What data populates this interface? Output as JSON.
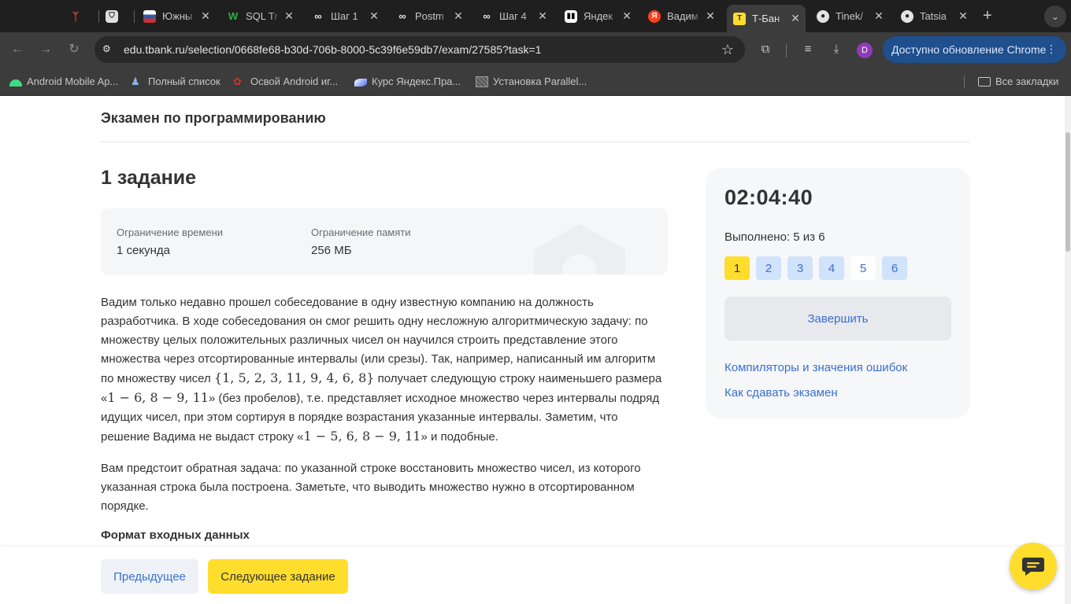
{
  "browser": {
    "tabs": [
      {
        "title": "",
        "icon": "red-figure-icon",
        "color": "#e53935"
      },
      {
        "title": "",
        "icon": "shield-icon",
        "color": "#3c3c3c"
      },
      {
        "title": "Южны",
        "icon": "flag-icon",
        "color": "#b44"
      },
      {
        "title": "SQL Tr",
        "icon": "w-logo-icon",
        "color": "#1b8a3a"
      },
      {
        "title": "Шаг 1",
        "icon": "stepik-icon",
        "color": "#2b2b2b"
      },
      {
        "title": "Postm",
        "icon": "stepik-icon",
        "color": "#2b2b2b"
      },
      {
        "title": "Шаг 4",
        "icon": "stepik-icon",
        "color": "#2b2b2b"
      },
      {
        "title": "Яндек",
        "icon": "yandex-practicum-icon",
        "color": "#222"
      },
      {
        "title": "Вадим",
        "icon": "yandex-icon",
        "color": "#fc3f1d"
      },
      {
        "title": "Т-Бан",
        "icon": "tbank-icon",
        "color": "#ffdd2d"
      },
      {
        "title": "Tinek/",
        "icon": "github-icon",
        "color": "#222"
      },
      {
        "title": "Tatsia",
        "icon": "github-icon",
        "color": "#222"
      }
    ],
    "url": "edu.tbank.ru/selection/0668fe68-b30d-706b-8000-5c39f6e59db7/exam/27585?task=1",
    "profile_letter": "D",
    "update_label": "Доступно обновление Chrome",
    "bookmarks": [
      {
        "label": "Android Mobile Ap...",
        "icon": "android-icon"
      },
      {
        "label": "Полный список",
        "icon": "wizard-icon"
      },
      {
        "label": "Освой Android иг...",
        "icon": "paw-icon"
      },
      {
        "label": "Курс Яндекс.Пра...",
        "icon": "practicum-icon"
      },
      {
        "label": "Установка Parallel...",
        "icon": "image-placeholder-icon"
      }
    ],
    "all_bookmarks": "Все закладки"
  },
  "page": {
    "exam_title": "Экзамен по программированию",
    "task_title": "1 задание",
    "limits": {
      "time_label": "Ограничение времени",
      "time_value": "1 секунда",
      "memory_label": "Ограничение памяти",
      "memory_value": "256 МБ"
    },
    "description": {
      "p1_a": "Вадим только недавно прошел собеседование в одну известную компанию на должность разработчика. В ходе собеседования он смог решить одну несложную алгоритмическую задачу: по множеству целых положительных различных чисел он научился строить представление этого множества через отсортированные интервалы (или срезы). Так, например, написанный им алгоритм по множеству чисел ",
      "p1_set": "{1, 5, 2, 3, 11, 9, 4, 6, 8}",
      "p1_b": " получает следующую строку наименьшего размера «",
      "p1_str": "1 − 6, 8 − 9, 11",
      "p1_c": "» (без пробелов), т.е. представляет исходное множество через интервалы подряд идущих чисел, при этом сортируя в порядке возрастания указанные интервалы. Заметим, что решение Вадима не выдаст строку «",
      "p1_bad": "1 − 5, 6, 8 − 9, 11",
      "p1_d": "» и подобные.",
      "p2": "Вам предстоит обратная задача: по указанной строке восстановить множество чисел, из которого указанная строка была построена. Заметьте, что выводить множество нужно в отсортированном порядке."
    },
    "input_format_heading": "Формат входных данных",
    "sidebar": {
      "timer": "02:04:40",
      "done": "Выполнено: 5 из 6",
      "tasks": [
        "1",
        "2",
        "3",
        "4",
        "5",
        "6"
      ],
      "finish": "Завершить",
      "link_compilers": "Компиляторы и значения ошибок",
      "link_howto": "Как сдавать экзамен"
    },
    "prev": "Предыдущее",
    "next": "Следующее задание"
  },
  "colors": {
    "accent_yellow": "#ffdd2d",
    "link_blue": "#3a6fd1"
  }
}
